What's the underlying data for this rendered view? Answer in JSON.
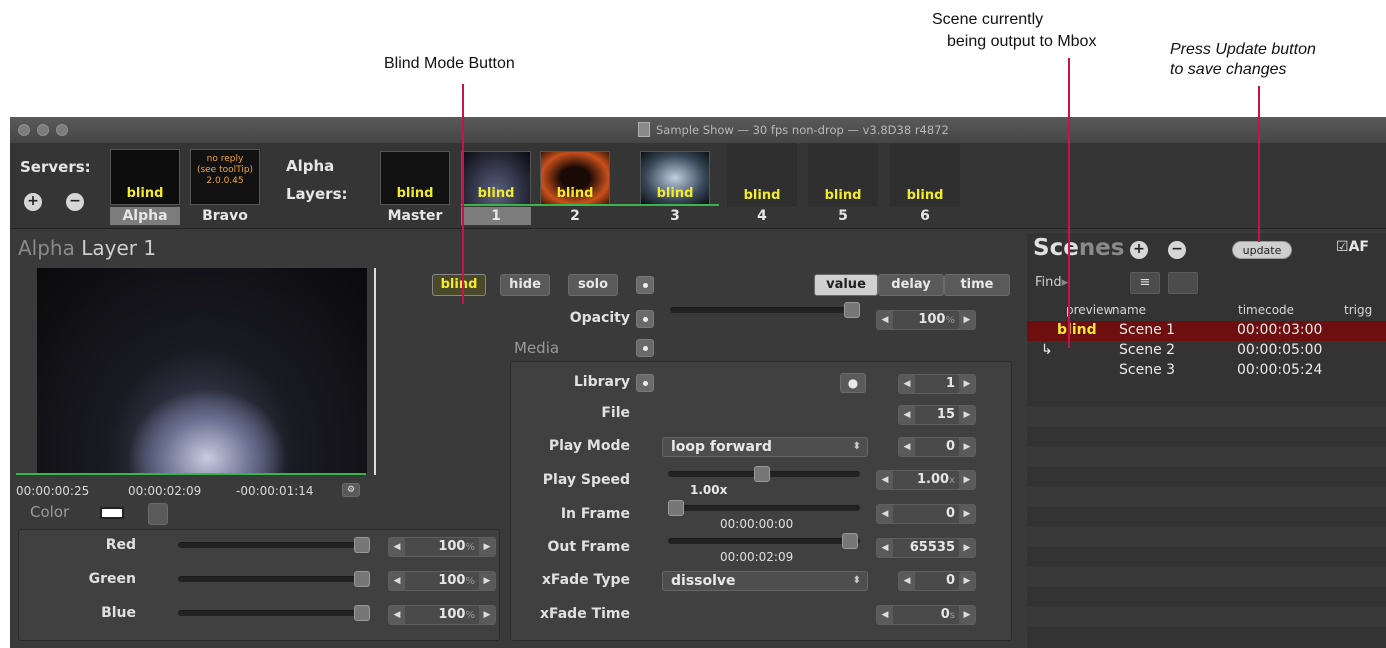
{
  "annotations": {
    "blind_mode": "Blind Mode Button",
    "scene_output": "Scene currently being output to Mbox",
    "scene_output_line1": "Scene currently",
    "scene_output_line2": "being output to Mbox",
    "press_update_line1": "Press Update button",
    "press_update_line2": "to save changes"
  },
  "window": {
    "title": "Sample Show  —  30 fps non-drop  —  v3.8D38 r4872"
  },
  "servers": {
    "label": "Servers:",
    "add": "+",
    "remove": "−",
    "items": [
      {
        "name": "Alpha",
        "thumb_label": "blind",
        "selected": true
      },
      {
        "name": "Bravo",
        "thumb_label": "",
        "status_line1": "no reply",
        "status_line2": "(see toolTip)",
        "status_line3": "2.0.0.45"
      }
    ]
  },
  "layers": {
    "server_name": "Alpha",
    "label": "Layers:",
    "items": [
      {
        "name": "Master",
        "thumb_label": "blind"
      },
      {
        "name": "1",
        "thumb_label": "blind",
        "selected": true
      },
      {
        "name": "2",
        "thumb_label": "blind"
      },
      {
        "name": "3",
        "thumb_label": "blind"
      },
      {
        "name": "4",
        "thumb_label": "blind"
      },
      {
        "name": "5",
        "thumb_label": "blind"
      },
      {
        "name": "6",
        "thumb_label": "blind"
      }
    ]
  },
  "layer_panel": {
    "server": "Alpha",
    "layer": "Layer 1",
    "timecodes": {
      "current": "00:00:00:25",
      "duration": "00:00:02:09",
      "remaining": "-00:00:01:14"
    },
    "color": {
      "label": "Color",
      "swatch": "#ffffff",
      "channels": [
        {
          "name": "Red",
          "value": "100",
          "unit": "%",
          "level": 1.0
        },
        {
          "name": "Green",
          "value": "100",
          "unit": "%",
          "level": 1.0
        },
        {
          "name": "Blue",
          "value": "100",
          "unit": "%",
          "level": 1.0
        }
      ]
    },
    "buttons": {
      "blind": "blind",
      "hide": "hide",
      "solo": "solo"
    },
    "segments": {
      "value": "value",
      "delay": "delay",
      "time": "time"
    },
    "opacity": {
      "label": "Opacity",
      "value": "100",
      "unit": "%"
    },
    "media": {
      "label": "Media",
      "library": {
        "label": "Library",
        "value": "1"
      },
      "file": {
        "label": "File",
        "value": "15"
      },
      "play_mode": {
        "label": "Play Mode",
        "selected": "loop forward",
        "value": "0"
      },
      "play_speed": {
        "label": "Play Speed",
        "display": "1.00x",
        "value": "1.00",
        "unit": "x"
      },
      "in_frame": {
        "label": "In Frame",
        "display": "00:00:00:00",
        "value": "0"
      },
      "out_frame": {
        "label": "Out Frame",
        "display": "00:00:02:09",
        "value": "65535"
      },
      "xfade_type": {
        "label": "xFade Type",
        "selected": "dissolve",
        "value": "0"
      },
      "xfade_time": {
        "label": "xFade Time",
        "value": "0",
        "unit": "s"
      }
    }
  },
  "scenes": {
    "title_bold": "Sce",
    "title_dim": "nes",
    "update": "update",
    "af": "AF",
    "find": "Find",
    "columns": {
      "preview": "preview",
      "name": "name",
      "timecode": "timecode",
      "trigger": "trigg"
    },
    "rows": [
      {
        "preview": "blind",
        "name": "Scene 1",
        "timecode": "00:00:03:00",
        "selected": true
      },
      {
        "preview": "↳",
        "name": "Scene 2",
        "timecode": "00:00:05:00"
      },
      {
        "preview": "",
        "name": "Scene 3",
        "timecode": "00:00:05:24"
      }
    ]
  },
  "colors": {
    "accent_yellow": "#f2ea2e",
    "selected_row": "#6e0e0e",
    "leader_line": "#c8124f",
    "timeline_green": "#39b54a"
  }
}
